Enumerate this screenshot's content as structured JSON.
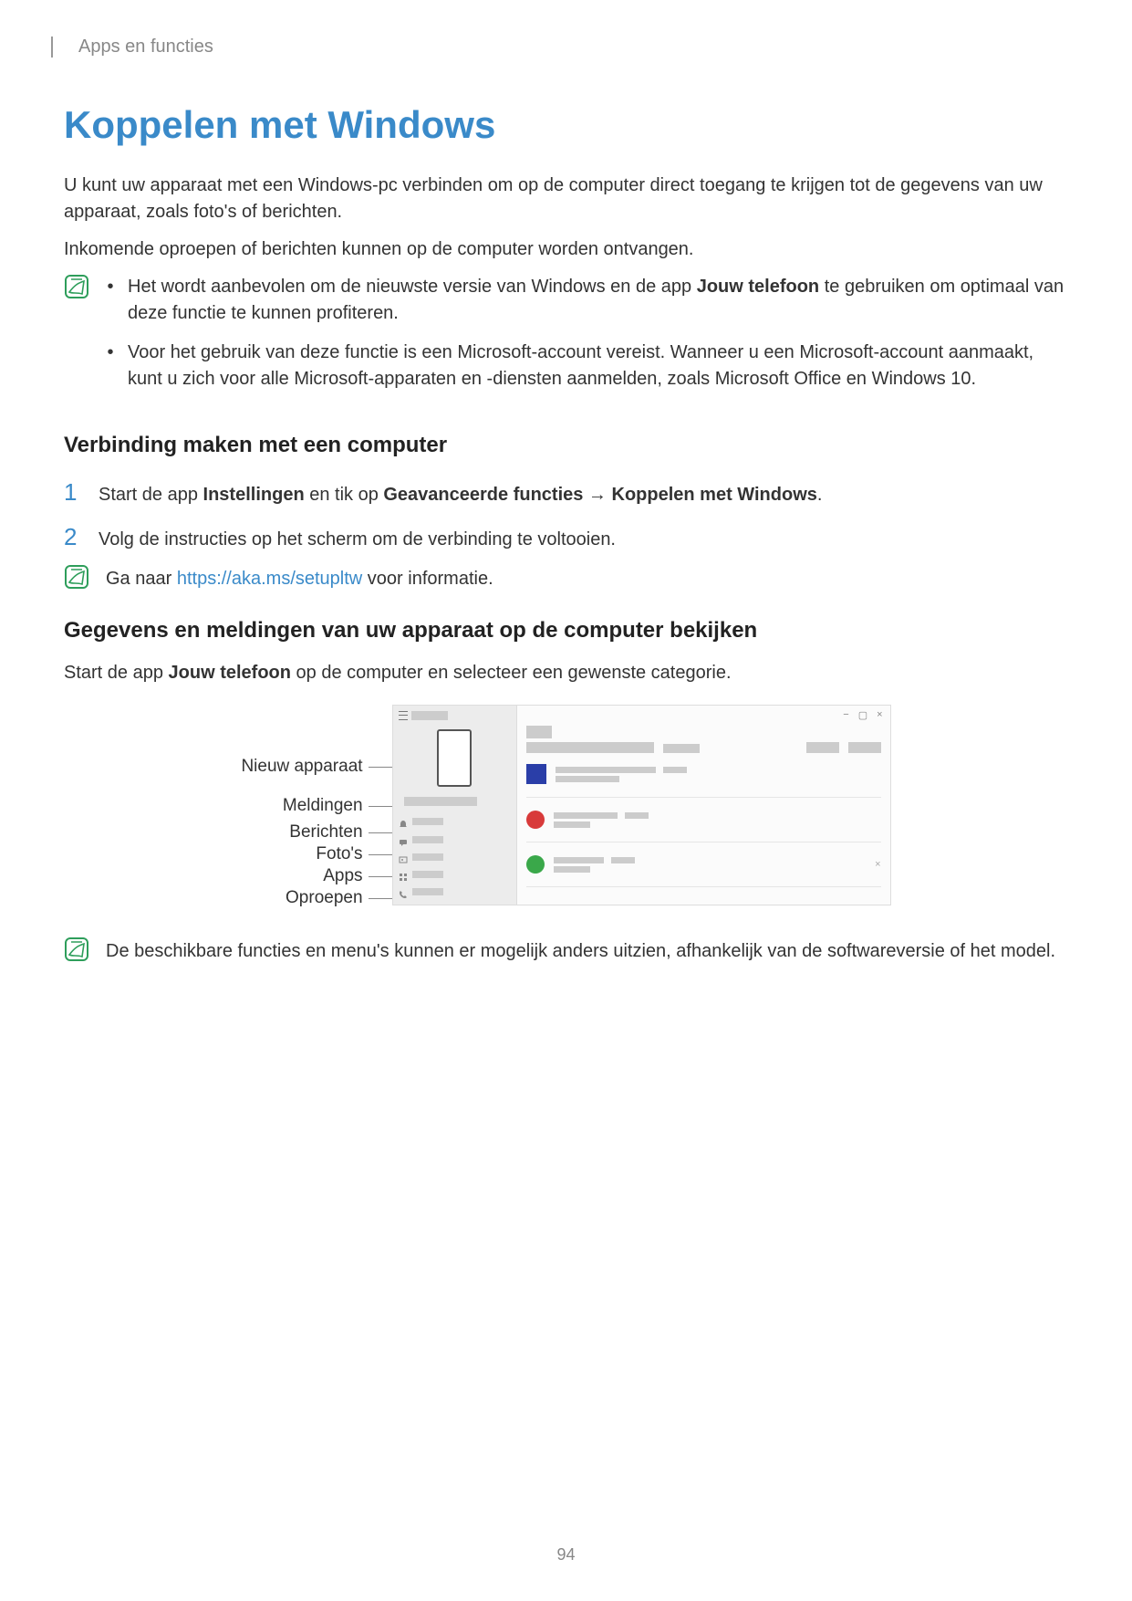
{
  "header": {
    "breadcrumb": "Apps en functies"
  },
  "title": "Koppelen met Windows",
  "intro1": "U kunt uw apparaat met een Windows-pc verbinden om op de computer direct toegang te krijgen tot de gegevens van uw apparaat, zoals foto's of berichten.",
  "intro2": "Inkomende oproepen of berichten kunnen op de computer worden ontvangen.",
  "note1": {
    "b1_a": "Het wordt aanbevolen om de nieuwste versie van Windows en de app ",
    "b1_bold": "Jouw telefoon",
    "b1_b": " te gebruiken om optimaal van deze functie te kunnen profiteren.",
    "b2": "Voor het gebruik van deze functie is een Microsoft-account vereist. Wanneer u een Microsoft-account aanmaakt, kunt u zich voor alle Microsoft-apparaten en -diensten aanmelden, zoals Microsoft Office en Windows 10."
  },
  "sub1": "Verbinding maken met een computer",
  "step1": {
    "a": "Start de app ",
    "b1": "Instellingen",
    "c": " en tik op ",
    "b2": "Geavanceerde functies",
    "arrow": " → ",
    "b3": "Koppelen met Windows",
    "d": "."
  },
  "step2": "Volg de instructies op het scherm om de verbinding te voltooien.",
  "note2": {
    "pre": "Ga naar ",
    "link": "https://aka.ms/setupltw",
    "post": " voor informatie."
  },
  "sub2": "Gegevens en meldingen van uw apparaat op de computer bekijken",
  "sub2_body": {
    "a": "Start de app ",
    "b": "Jouw telefoon",
    "c": " op de computer en selecteer een gewenste categorie."
  },
  "figure": {
    "labels": [
      "Nieuw apparaat",
      "Meldingen",
      "Berichten",
      "Foto's",
      "Apps",
      "Oproepen"
    ]
  },
  "note3": "De beschikbare functies en menu's kunnen er mogelijk anders uitzien, afhankelijk van de softwareversie of het model.",
  "page_number": "94"
}
